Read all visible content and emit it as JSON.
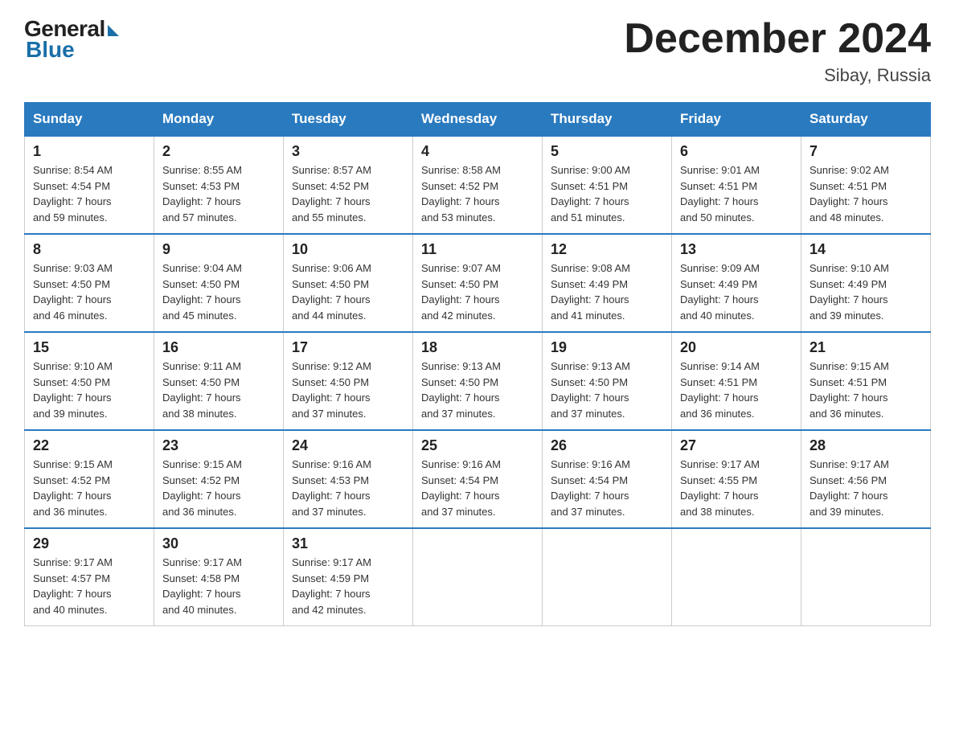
{
  "logo": {
    "general": "General",
    "blue": "Blue"
  },
  "title": "December 2024",
  "location": "Sibay, Russia",
  "days_of_week": [
    "Sunday",
    "Monday",
    "Tuesday",
    "Wednesday",
    "Thursday",
    "Friday",
    "Saturday"
  ],
  "weeks": [
    [
      {
        "day": "1",
        "info": "Sunrise: 8:54 AM\nSunset: 4:54 PM\nDaylight: 7 hours\nand 59 minutes."
      },
      {
        "day": "2",
        "info": "Sunrise: 8:55 AM\nSunset: 4:53 PM\nDaylight: 7 hours\nand 57 minutes."
      },
      {
        "day": "3",
        "info": "Sunrise: 8:57 AM\nSunset: 4:52 PM\nDaylight: 7 hours\nand 55 minutes."
      },
      {
        "day": "4",
        "info": "Sunrise: 8:58 AM\nSunset: 4:52 PM\nDaylight: 7 hours\nand 53 minutes."
      },
      {
        "day": "5",
        "info": "Sunrise: 9:00 AM\nSunset: 4:51 PM\nDaylight: 7 hours\nand 51 minutes."
      },
      {
        "day": "6",
        "info": "Sunrise: 9:01 AM\nSunset: 4:51 PM\nDaylight: 7 hours\nand 50 minutes."
      },
      {
        "day": "7",
        "info": "Sunrise: 9:02 AM\nSunset: 4:51 PM\nDaylight: 7 hours\nand 48 minutes."
      }
    ],
    [
      {
        "day": "8",
        "info": "Sunrise: 9:03 AM\nSunset: 4:50 PM\nDaylight: 7 hours\nand 46 minutes."
      },
      {
        "day": "9",
        "info": "Sunrise: 9:04 AM\nSunset: 4:50 PM\nDaylight: 7 hours\nand 45 minutes."
      },
      {
        "day": "10",
        "info": "Sunrise: 9:06 AM\nSunset: 4:50 PM\nDaylight: 7 hours\nand 44 minutes."
      },
      {
        "day": "11",
        "info": "Sunrise: 9:07 AM\nSunset: 4:50 PM\nDaylight: 7 hours\nand 42 minutes."
      },
      {
        "day": "12",
        "info": "Sunrise: 9:08 AM\nSunset: 4:49 PM\nDaylight: 7 hours\nand 41 minutes."
      },
      {
        "day": "13",
        "info": "Sunrise: 9:09 AM\nSunset: 4:49 PM\nDaylight: 7 hours\nand 40 minutes."
      },
      {
        "day": "14",
        "info": "Sunrise: 9:10 AM\nSunset: 4:49 PM\nDaylight: 7 hours\nand 39 minutes."
      }
    ],
    [
      {
        "day": "15",
        "info": "Sunrise: 9:10 AM\nSunset: 4:50 PM\nDaylight: 7 hours\nand 39 minutes."
      },
      {
        "day": "16",
        "info": "Sunrise: 9:11 AM\nSunset: 4:50 PM\nDaylight: 7 hours\nand 38 minutes."
      },
      {
        "day": "17",
        "info": "Sunrise: 9:12 AM\nSunset: 4:50 PM\nDaylight: 7 hours\nand 37 minutes."
      },
      {
        "day": "18",
        "info": "Sunrise: 9:13 AM\nSunset: 4:50 PM\nDaylight: 7 hours\nand 37 minutes."
      },
      {
        "day": "19",
        "info": "Sunrise: 9:13 AM\nSunset: 4:50 PM\nDaylight: 7 hours\nand 37 minutes."
      },
      {
        "day": "20",
        "info": "Sunrise: 9:14 AM\nSunset: 4:51 PM\nDaylight: 7 hours\nand 36 minutes."
      },
      {
        "day": "21",
        "info": "Sunrise: 9:15 AM\nSunset: 4:51 PM\nDaylight: 7 hours\nand 36 minutes."
      }
    ],
    [
      {
        "day": "22",
        "info": "Sunrise: 9:15 AM\nSunset: 4:52 PM\nDaylight: 7 hours\nand 36 minutes."
      },
      {
        "day": "23",
        "info": "Sunrise: 9:15 AM\nSunset: 4:52 PM\nDaylight: 7 hours\nand 36 minutes."
      },
      {
        "day": "24",
        "info": "Sunrise: 9:16 AM\nSunset: 4:53 PM\nDaylight: 7 hours\nand 37 minutes."
      },
      {
        "day": "25",
        "info": "Sunrise: 9:16 AM\nSunset: 4:54 PM\nDaylight: 7 hours\nand 37 minutes."
      },
      {
        "day": "26",
        "info": "Sunrise: 9:16 AM\nSunset: 4:54 PM\nDaylight: 7 hours\nand 37 minutes."
      },
      {
        "day": "27",
        "info": "Sunrise: 9:17 AM\nSunset: 4:55 PM\nDaylight: 7 hours\nand 38 minutes."
      },
      {
        "day": "28",
        "info": "Sunrise: 9:17 AM\nSunset: 4:56 PM\nDaylight: 7 hours\nand 39 minutes."
      }
    ],
    [
      {
        "day": "29",
        "info": "Sunrise: 9:17 AM\nSunset: 4:57 PM\nDaylight: 7 hours\nand 40 minutes."
      },
      {
        "day": "30",
        "info": "Sunrise: 9:17 AM\nSunset: 4:58 PM\nDaylight: 7 hours\nand 40 minutes."
      },
      {
        "day": "31",
        "info": "Sunrise: 9:17 AM\nSunset: 4:59 PM\nDaylight: 7 hours\nand 42 minutes."
      },
      {
        "day": "",
        "info": ""
      },
      {
        "day": "",
        "info": ""
      },
      {
        "day": "",
        "info": ""
      },
      {
        "day": "",
        "info": ""
      }
    ]
  ]
}
